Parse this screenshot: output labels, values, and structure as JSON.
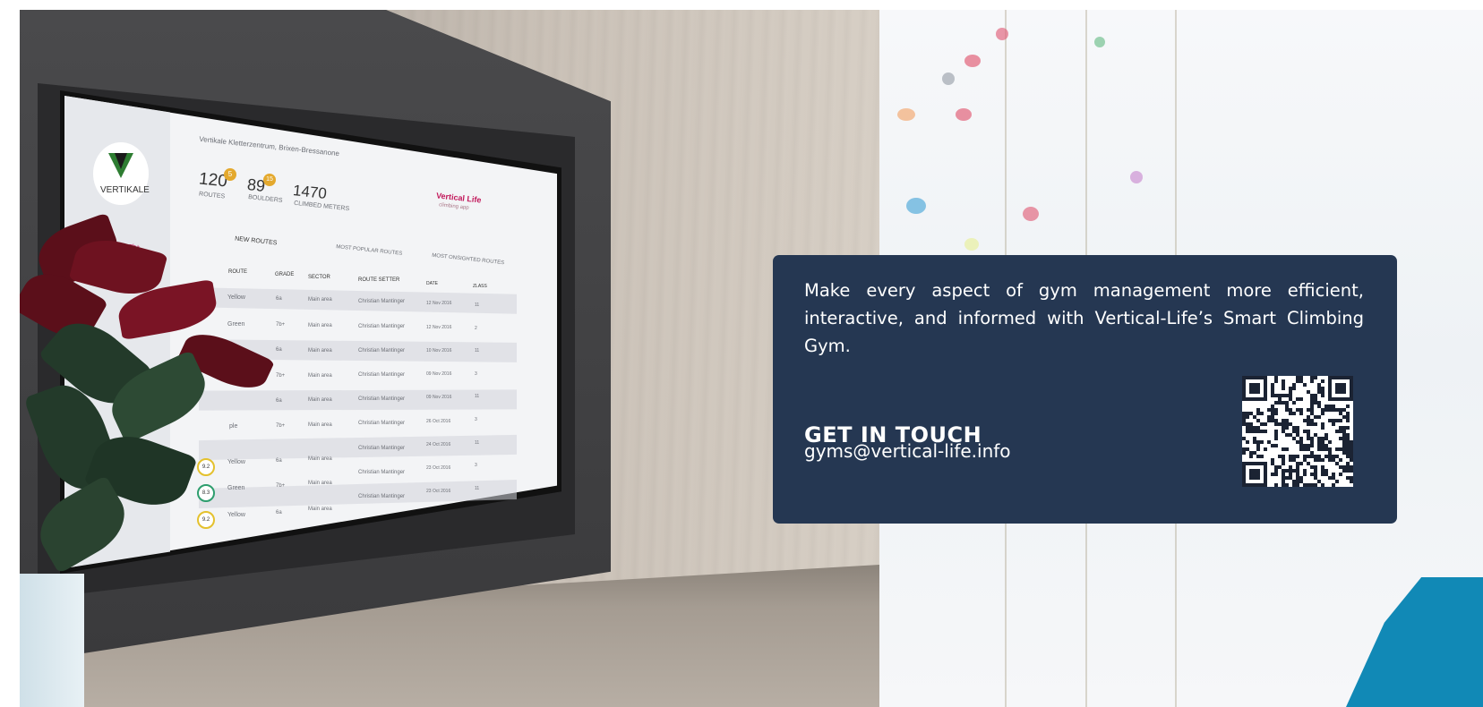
{
  "photo": {
    "tv_screen": {
      "gym_name": "Vertikale Kletterzentrum, Brixen-Bressanone",
      "logo_text": "VERTIKALE",
      "stats": [
        {
          "value": "120",
          "badge": "5",
          "label": "ROUTES"
        },
        {
          "value": "89",
          "badge": "15",
          "label": "BOULDERS"
        },
        {
          "value": "1470",
          "label": "CLIMBED METERS"
        }
      ],
      "brand": "Vertical Life",
      "brand_sub": "climbing app",
      "tabs": [
        "NEW ROUTES",
        "MOST POPULAR ROUTES",
        "MOST ONSIGHTED ROUTES"
      ],
      "columns": [
        "ROUTE",
        "GRADE",
        "SECTOR",
        "ROUTE SETTER",
        "DATE",
        "ZLASS"
      ],
      "side_label": "Purple 7b+",
      "rows": [
        {
          "route": "Yellow",
          "grade": "6a",
          "sector": "Main area",
          "setter": "Christian Mantinger",
          "date": "12 Nov 2016",
          "zlass": "11"
        },
        {
          "route": "Green",
          "grade": "7b+",
          "sector": "Main area",
          "setter": "Christian Mantinger",
          "date": "12 Nov 2016",
          "zlass": "2"
        },
        {
          "route": "",
          "grade": "6a",
          "sector": "Main area",
          "setter": "Christian Mantinger",
          "date": "10 Nov 2016",
          "zlass": "11"
        },
        {
          "route": "",
          "grade": "7b+",
          "sector": "Main area",
          "setter": "Christian Mantinger",
          "date": "09 Nov 2016",
          "zlass": "3"
        },
        {
          "route": "",
          "grade": "6a",
          "sector": "Main area",
          "setter": "Christian Mantinger",
          "date": "09 Nov 2016",
          "zlass": "11"
        },
        {
          "route": "ple",
          "grade": "7b+",
          "sector": "Main area",
          "setter": "Christian Mantinger",
          "date": "26 Oct 2016",
          "zlass": "3"
        },
        {
          "route": "Yellow",
          "grade": "6a",
          "sector": "Main area",
          "setter": "Christian Mantinger",
          "date": "24 Oct 2016",
          "zlass": "11"
        },
        {
          "route": "Green",
          "grade": "7b+",
          "sector": "Main area",
          "setter": "Christian Mantinger",
          "date": "23 Oct 2016",
          "zlass": "3"
        },
        {
          "route": "Yellow",
          "grade": "6a",
          "sector": "Main area",
          "setter": "Christian Mantinger",
          "date": "23 Oct 2016",
          "zlass": "11"
        }
      ],
      "row_badges": [
        "9.2",
        "8.3",
        "9.2"
      ]
    }
  },
  "card": {
    "description": "Make every aspect of gym management more efficient, interactive, and informed with Vertical-Life’s Smart Climbing Gym.",
    "cta_title": "GET IN TOUCH",
    "email": "gyms@vertical-life.info"
  },
  "colors": {
    "card_background": "#253752",
    "accent_corner": "#1189b6",
    "text": "#ffffff"
  },
  "icons": {
    "qr": "qr-code-icon"
  }
}
